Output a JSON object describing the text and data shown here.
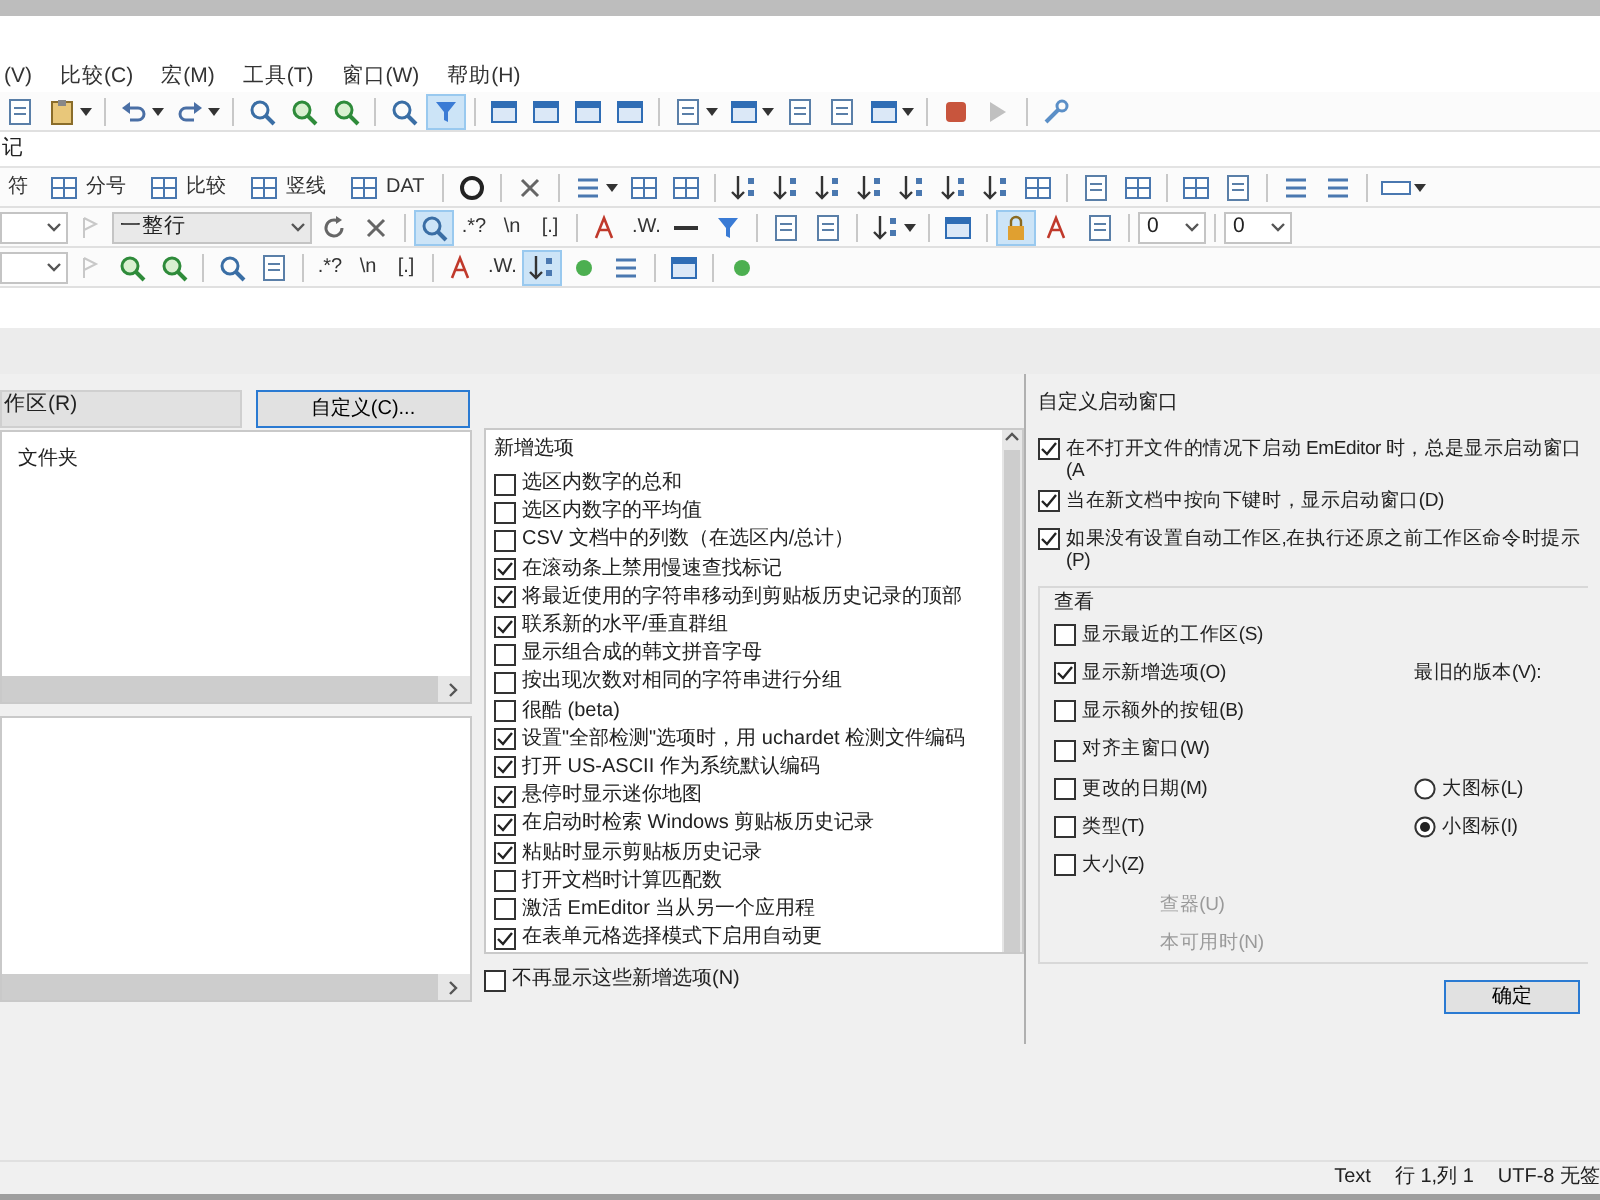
{
  "menu": [
    {
      "label": "(V)"
    },
    {
      "label": "比较(C)"
    },
    {
      "label": "宏(M)"
    },
    {
      "label": "工具(T)"
    },
    {
      "label": "窗口(W)"
    },
    {
      "label": "帮助(H)"
    }
  ],
  "toolbars": [
    {
      "items": [
        {
          "kind": "icon",
          "pressed": false
        },
        {
          "kind": "icon_menu",
          "pressed": false
        },
        {
          "kind": "separator"
        },
        {
          "kind": "icon_menu",
          "pressed": false
        },
        {
          "kind": "icon_menu",
          "pressed": false
        },
        {
          "kind": "separator"
        },
        {
          "kind": "icon",
          "pressed": false
        },
        {
          "kind": "icon",
          "pressed": false
        },
        {
          "kind": "icon",
          "pressed": false
        },
        {
          "kind": "separator"
        },
        {
          "kind": "icon",
          "pressed": false
        },
        {
          "kind": "icon",
          "pressed": true
        },
        {
          "kind": "separator"
        },
        {
          "kind": "icon",
          "pressed": false
        },
        {
          "kind": "icon",
          "pressed": false
        },
        {
          "kind": "icon",
          "pressed": false
        },
        {
          "kind": "icon",
          "pressed": false
        },
        {
          "kind": "separator"
        },
        {
          "kind": "icon_menu",
          "pressed": false
        },
        {
          "kind": "icon_menu",
          "pressed": false
        },
        {
          "kind": "icon",
          "pressed": false
        },
        {
          "kind": "icon",
          "pressed": false
        },
        {
          "kind": "icon_menu",
          "pressed": false
        },
        {
          "kind": "separator"
        },
        {
          "kind": "icon",
          "pressed": false
        },
        {
          "kind": "icon",
          "pressed": false
        },
        {
          "kind": "separator"
        },
        {
          "kind": "icon",
          "pressed": false
        }
      ]
    },
    {
      "items": [
        {
          "kind": "text",
          "label": "符"
        },
        {
          "kind": "labeled",
          "label": "分号"
        },
        {
          "kind": "labeled",
          "label": "比较"
        },
        {
          "kind": "labeled",
          "label": "竖线"
        },
        {
          "kind": "labeled",
          "label": "DAT"
        },
        {
          "kind": "separator"
        },
        {
          "kind": "icon",
          "pressed": false
        },
        {
          "kind": "separator"
        },
        {
          "kind": "icon",
          "pressed": false
        },
        {
          "kind": "separator"
        },
        {
          "kind": "icon_menu",
          "pressed": false
        },
        {
          "kind": "icon",
          "pressed": false
        },
        {
          "kind": "icon",
          "pressed": false
        },
        {
          "kind": "separator"
        },
        {
          "kind": "icon",
          "pressed": false
        },
        {
          "kind": "icon",
          "pressed": false
        },
        {
          "kind": "icon",
          "pressed": false
        },
        {
          "kind": "icon",
          "pressed": false
        },
        {
          "kind": "icon",
          "pressed": false
        },
        {
          "kind": "icon",
          "pressed": false
        },
        {
          "kind": "icon",
          "pressed": false
        },
        {
          "kind": "icon",
          "pressed": false
        },
        {
          "kind": "separator"
        },
        {
          "kind": "icon",
          "pressed": false
        },
        {
          "kind": "icon",
          "pressed": false
        },
        {
          "kind": "separator"
        },
        {
          "kind": "icon",
          "pressed": false
        },
        {
          "kind": "icon",
          "pressed": false
        },
        {
          "kind": "separator"
        },
        {
          "kind": "icon",
          "pressed": false
        },
        {
          "kind": "icon",
          "pressed": false
        },
        {
          "kind": "separator"
        },
        {
          "kind": "icon_menu",
          "pressed": false
        }
      ]
    },
    {
      "items": [
        {
          "kind": "combo"
        },
        {
          "kind": "icon",
          "pressed": false
        },
        {
          "kind": "combo_wide",
          "value": "一整行"
        },
        {
          "kind": "icon",
          "pressed": false
        },
        {
          "kind": "icon",
          "pressed": false
        },
        {
          "kind": "separator"
        },
        {
          "kind": "icon",
          "pressed": true
        },
        {
          "kind": "text",
          "label": ".*?"
        },
        {
          "kind": "text",
          "label": "\\n"
        },
        {
          "kind": "text",
          "label": "[.]"
        },
        {
          "kind": "separator"
        },
        {
          "kind": "icon",
          "pressed": false
        },
        {
          "kind": "text",
          "label": ".W."
        },
        {
          "kind": "icon",
          "pressed": false
        },
        {
          "kind": "icon",
          "pressed": false
        },
        {
          "kind": "separator"
        },
        {
          "kind": "icon",
          "pressed": false
        },
        {
          "kind": "icon",
          "pressed": false
        },
        {
          "kind": "separator"
        },
        {
          "kind": "icon_menu",
          "pressed": false
        },
        {
          "kind": "separator"
        },
        {
          "kind": "icon",
          "pressed": false
        },
        {
          "kind": "separator"
        },
        {
          "kind": "icon",
          "pressed": true
        },
        {
          "kind": "icon",
          "pressed": false
        },
        {
          "kind": "icon",
          "pressed": false
        },
        {
          "kind": "separator"
        },
        {
          "kind": "combo",
          "value": "0"
        },
        {
          "kind": "separator"
        },
        {
          "kind": "combo",
          "value": "0"
        }
      ]
    },
    {
      "items": [
        {
          "kind": "combo"
        },
        {
          "kind": "icon",
          "pressed": false
        },
        {
          "kind": "icon",
          "pressed": false
        },
        {
          "kind": "icon",
          "pressed": false
        },
        {
          "kind": "separator"
        },
        {
          "kind": "icon",
          "pressed": false
        },
        {
          "kind": "icon",
          "pressed": false
        },
        {
          "kind": "separator"
        },
        {
          "kind": "text",
          "label": ".*?"
        },
        {
          "kind": "text",
          "label": "\\n"
        },
        {
          "kind": "text",
          "label": "[.]"
        },
        {
          "kind": "separator"
        },
        {
          "kind": "icon",
          "pressed": false
        },
        {
          "kind": "text",
          "label": ".W."
        },
        {
          "kind": "icon",
          "pressed": true
        },
        {
          "kind": "icon",
          "pressed": false
        },
        {
          "kind": "icon",
          "pressed": false
        },
        {
          "kind": "separator"
        },
        {
          "kind": "icon",
          "pressed": false
        },
        {
          "kind": "separator"
        },
        {
          "kind": "icon",
          "pressed": false
        }
      ]
    }
  ],
  "tab": {
    "label": "记"
  },
  "workspace": {
    "field": "作区(R)",
    "customize_button": "自定义(C)...",
    "column": "文件夹"
  },
  "new_options": {
    "title": "新增选项",
    "items": [
      {
        "label": "选区内数字的总和",
        "checked": false
      },
      {
        "label": "选区内数字的平均值",
        "checked": false
      },
      {
        "label": "CSV 文档中的列数（在选区内/总计）",
        "checked": false
      },
      {
        "label": "在滚动条上禁用慢速查找标记",
        "checked": true
      },
      {
        "label": "将最近使用的字符串移动到剪贴板历史记录的顶部",
        "checked": true
      },
      {
        "label": "联系新的水平/垂直群组",
        "checked": true
      },
      {
        "label": "显示组合成的韩文拼音字母",
        "checked": false
      },
      {
        "label": "按出现次数对相同的字符串进行分组",
        "checked": false
      },
      {
        "label": "很酷 (beta)",
        "checked": false
      },
      {
        "label": "设置\"全部检测\"选项时，用 uchardet 检测文件编码",
        "checked": true
      },
      {
        "label": "打开 US-ASCII 作为系统默认编码",
        "checked": true
      },
      {
        "label": "悬停时显示迷你地图",
        "checked": true
      },
      {
        "label": "在启动时检索 Windows 剪贴板历史记录",
        "checked": true
      },
      {
        "label": "粘贴时显示剪贴板历史记录",
        "checked": true
      },
      {
        "label": "打开文档时计算匹配数",
        "checked": false
      },
      {
        "label": "激活 EmEditor 当从另一个应用程",
        "checked": false
      },
      {
        "label": "在表单元格选择模式下启用自动更",
        "checked": true
      }
    ],
    "dont_show": {
      "label": "不再显示这些新增选项(N)",
      "checked": false
    }
  },
  "startup_dialog": {
    "title": "自定义启动窗口",
    "options": [
      {
        "label": "在不打开文件的情况下启动 EmEditor 时，总是显示启动窗口(A",
        "checked": true
      },
      {
        "label": "当在新文档中按向下键时，显示启动窗口(D)",
        "checked": true
      },
      {
        "label": "如果没有设置自动工作区,在执行还原之前工作区命令时提示(P)",
        "checked": true
      }
    ],
    "view": {
      "title": "查看",
      "options": [
        {
          "label": "显示最近的工作区(S)",
          "checked": false
        },
        {
          "label": "显示新增选项(O)",
          "checked": true
        },
        {
          "label": "显示额外的按钮(B)",
          "checked": false
        },
        {
          "label": "对齐主窗口(W)",
          "checked": false
        },
        {
          "label": "更改的日期(M)",
          "checked": false
        },
        {
          "label": "类型(T)",
          "checked": false
        },
        {
          "label": "大小(Z)",
          "checked": false
        }
      ],
      "oldest_version": "最旧的版本(V):",
      "icon_sizes": [
        {
          "label": "大图标(L)",
          "selected": false
        },
        {
          "label": "小图标(I)",
          "selected": true
        }
      ],
      "partial_options": [
        {
          "label": "查器(U)"
        },
        {
          "label": "本可用时(N)"
        }
      ]
    },
    "ok_button": "确定"
  },
  "status_bar": {
    "mode": "Text",
    "position": "行 1,列 1",
    "encoding": "UTF-8 无签"
  }
}
